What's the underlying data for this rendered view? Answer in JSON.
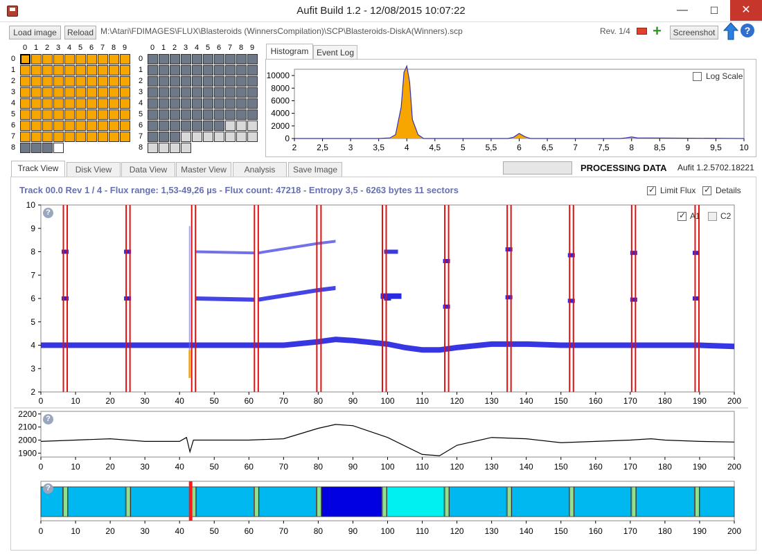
{
  "window": {
    "title": "Aufit Build 1.2 - 12/08/2015 10:07:22",
    "minimize": "—",
    "maximize": "☐",
    "close": "✕"
  },
  "toolbar": {
    "load_label": "Load image",
    "reload_label": "Reload",
    "path": "M:\\Atari\\FDIMAGES\\FLUX\\Blasteroids (WinnersCompilation)\\SCP\\Blasteroids-DiskA(Winners).scp",
    "rev_label": "Rev. 1/4",
    "screenshot_label": "Screenshot"
  },
  "track_grid": {
    "col_labels": [
      "0",
      "1",
      "2",
      "3",
      "4",
      "5",
      "6",
      "7",
      "8",
      "9"
    ],
    "row_labels": [
      "0",
      "1",
      "2",
      "3",
      "4",
      "5",
      "6",
      "7",
      "8"
    ]
  },
  "histogram": {
    "tabs": [
      "Histogram",
      "Event Log"
    ],
    "log_scale_label": "Log Scale",
    "y_ticks": [
      "0",
      "2000",
      "4000",
      "6000",
      "8000",
      "10000"
    ],
    "x_ticks": [
      "2",
      "2,5",
      "3",
      "3,5",
      "4",
      "4,5",
      "5",
      "5,5",
      "6",
      "6,5",
      "7",
      "7,5",
      "8",
      "8,5",
      "9",
      "9,5",
      "10"
    ],
    "chart_data": {
      "type": "area",
      "x": [
        2,
        3,
        3.5,
        3.7,
        3.8,
        3.9,
        3.95,
        4.0,
        4.05,
        4.1,
        4.2,
        4.3,
        5.5,
        5.8,
        5.9,
        6.0,
        6.1,
        6.2,
        7.8,
        7.9,
        8.0,
        8.1,
        10
      ],
      "values": [
        0,
        0,
        0,
        100,
        600,
        5000,
        10500,
        11500,
        9000,
        3000,
        600,
        0,
        0,
        0,
        200,
        800,
        300,
        0,
        0,
        100,
        250,
        100,
        0
      ],
      "xlim": [
        2,
        10
      ],
      "ylim": [
        0,
        11000
      ]
    }
  },
  "main_tabs": [
    "Track View",
    "Disk View",
    "Data View",
    "Master View",
    "Analysis",
    "Save Image"
  ],
  "status": {
    "processing": "PROCESSING DATA",
    "version": "Aufit 1.2.5702.18221"
  },
  "track_info": "Track 00.0 Rev 1 / 4 - Flux range: 1,53-49,26 µs - Flux count: 47218 - Entropy 3,5 - 6263 bytes 11 sectors",
  "options": {
    "limit_flux": "Limit Flux",
    "details": "Details",
    "a1": "A1",
    "c2": "C2"
  },
  "flux_chart": {
    "y_ticks": [
      "2",
      "3",
      "4",
      "5",
      "6",
      "7",
      "8",
      "9",
      "10"
    ],
    "x_ticks": [
      "0",
      "10",
      "20",
      "30",
      "40",
      "50",
      "60",
      "70",
      "80",
      "90",
      "100",
      "110",
      "120",
      "130",
      "140",
      "150",
      "160",
      "170",
      "180",
      "190",
      "200"
    ],
    "chart_data": {
      "type": "scatter",
      "xlim": [
        0,
        200
      ],
      "ylim": [
        2,
        10
      ],
      "baseline_x": [
        0,
        40,
        60,
        70,
        80,
        85,
        90,
        100,
        105,
        110,
        115,
        120,
        130,
        140,
        150,
        160,
        170,
        180,
        190,
        200
      ],
      "baseline_y": [
        4.0,
        4.0,
        4.0,
        4.0,
        4.15,
        4.25,
        4.2,
        4.05,
        3.9,
        3.8,
        3.8,
        3.9,
        4.05,
        4.05,
        4.0,
        4.0,
        4.0,
        4.0,
        4.0,
        3.95
      ],
      "sector_lines": [
        6.5,
        7.6,
        24.6,
        25.7,
        43.5,
        44.6,
        61.6,
        62.7,
        79.6,
        80.8,
        98.5,
        99.6,
        116.5,
        117.6,
        134.5,
        135.6,
        152.5,
        153.6,
        170.4,
        171.5,
        188.7,
        189.8
      ]
    }
  },
  "ticks_chart": {
    "y_ticks": [
      "1900",
      "2000",
      "2100",
      "2200"
    ],
    "x_ticks": [
      "0",
      "10",
      "20",
      "30",
      "40",
      "50",
      "60",
      "70",
      "80",
      "90",
      "100",
      "110",
      "120",
      "130",
      "140",
      "150",
      "160",
      "170",
      "180",
      "190",
      "200"
    ],
    "chart_data": {
      "type": "line",
      "xlim": [
        0,
        200
      ],
      "ylim": [
        1870,
        2220
      ],
      "x": [
        0,
        10,
        20,
        30,
        40,
        42,
        43,
        44,
        50,
        60,
        70,
        80,
        85,
        90,
        100,
        110,
        115,
        120,
        130,
        140,
        150,
        160,
        170,
        176,
        180,
        190,
        200
      ],
      "values": [
        1990,
        2000,
        2010,
        1990,
        1990,
        2020,
        1910,
        2000,
        2000,
        2000,
        2010,
        2090,
        2120,
        2110,
        2020,
        1890,
        1880,
        1960,
        2020,
        2010,
        1980,
        1990,
        2000,
        2010,
        2000,
        1990,
        1985
      ]
    }
  },
  "sector_bar": {
    "x_ticks": [
      "0",
      "10",
      "20",
      "30",
      "40",
      "50",
      "60",
      "70",
      "80",
      "90",
      "100",
      "110",
      "120",
      "130",
      "140",
      "150",
      "160",
      "170",
      "180",
      "190",
      "200"
    ]
  }
}
